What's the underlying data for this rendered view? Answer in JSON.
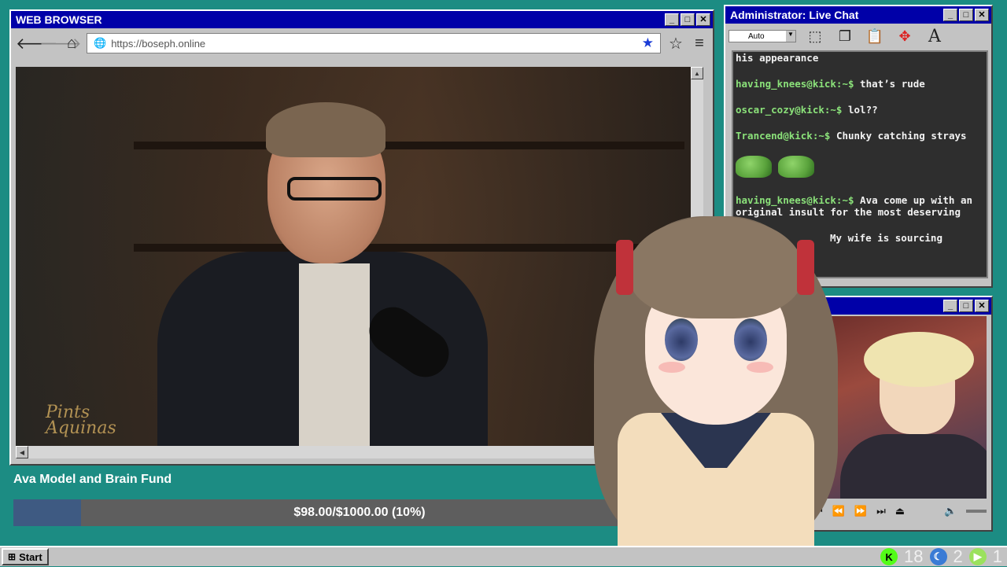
{
  "browser": {
    "title": "WEB BROWSER",
    "url": "https://boseph.online",
    "video_watermark": "Pints Aquinas"
  },
  "chat": {
    "title": "Administrator: Live Chat",
    "font_size_select": "Auto",
    "messages": [
      {
        "user": "",
        "text": "his appearance"
      },
      {
        "user": "having_knees@kick:~$",
        "text": "that’s rude"
      },
      {
        "user": "oscar_cozy@kick:~$",
        "text": "lol??"
      },
      {
        "user": "Trancend@kick:~$",
        "text": "Chunky catching strays"
      },
      {
        "user": "",
        "text": "",
        "emotes": 2
      },
      {
        "user": "having_knees@kick:~$",
        "text": "Ava come up with an original insult for the most deserving"
      },
      {
        "user": "",
        "text": "My wife is sourcing"
      }
    ]
  },
  "fund": {
    "title": "Ava Model and Brain Fund",
    "progress_text": "$98.00/$1000.00 (10%)",
    "progress_fraction": 0.098
  },
  "taskbar": {
    "start_label": "Start",
    "tray_counts": [
      "18",
      "2",
      "1"
    ]
  },
  "colors": {
    "desktop": "#1c8c83",
    "titlebar": "#0000a8",
    "chat_username": "#8be27a",
    "fund_fill": "#3e5a82"
  }
}
